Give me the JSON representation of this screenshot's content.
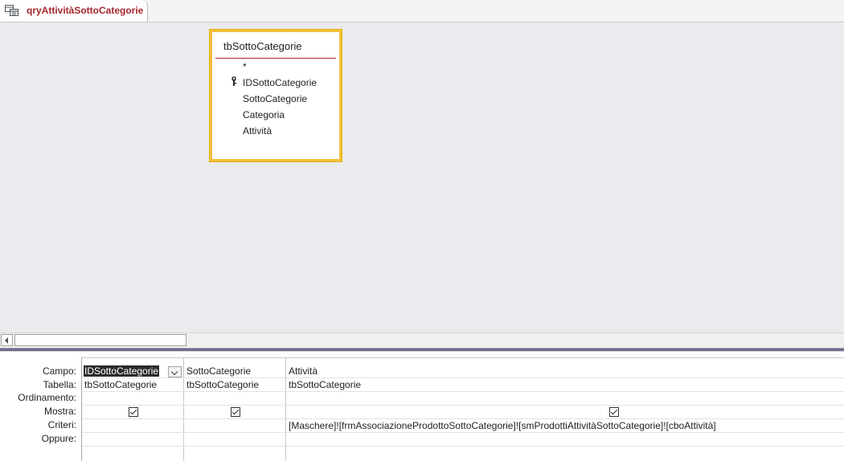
{
  "tab": {
    "label": "qryAttivitàSottoCategorie"
  },
  "table": {
    "name": "tbSottoCategorie",
    "fields": [
      "*",
      "IDSottoCategorie",
      "SottoCategorie",
      "Categoria",
      "Attività"
    ],
    "primary_key_field": "IDSottoCategorie",
    "highlight_color": "#f3c13a"
  },
  "grid": {
    "row_labels": {
      "field": "Campo:",
      "table": "Tabella:",
      "sort": "Ordinamento:",
      "show": "Mostra:",
      "criteria": "Criteri:",
      "or": "Oppure:"
    },
    "columns": [
      {
        "field": "IDSottoCategorie",
        "table": "tbSottoCategorie",
        "sort": "",
        "show": true,
        "criteria": ""
      },
      {
        "field": "SottoCategorie",
        "table": "tbSottoCategorie",
        "sort": "",
        "show": true,
        "criteria": ""
      },
      {
        "field": "Attività",
        "table": "tbSottoCategorie",
        "sort": "",
        "show": true,
        "criteria": "[Maschere]![frmAssociazioneProdottoSottoCategorie]![smProdottiAttivitàSottoCategorie]![cboAttività]"
      }
    ],
    "selected_cell": "IDSottoCategorie"
  }
}
